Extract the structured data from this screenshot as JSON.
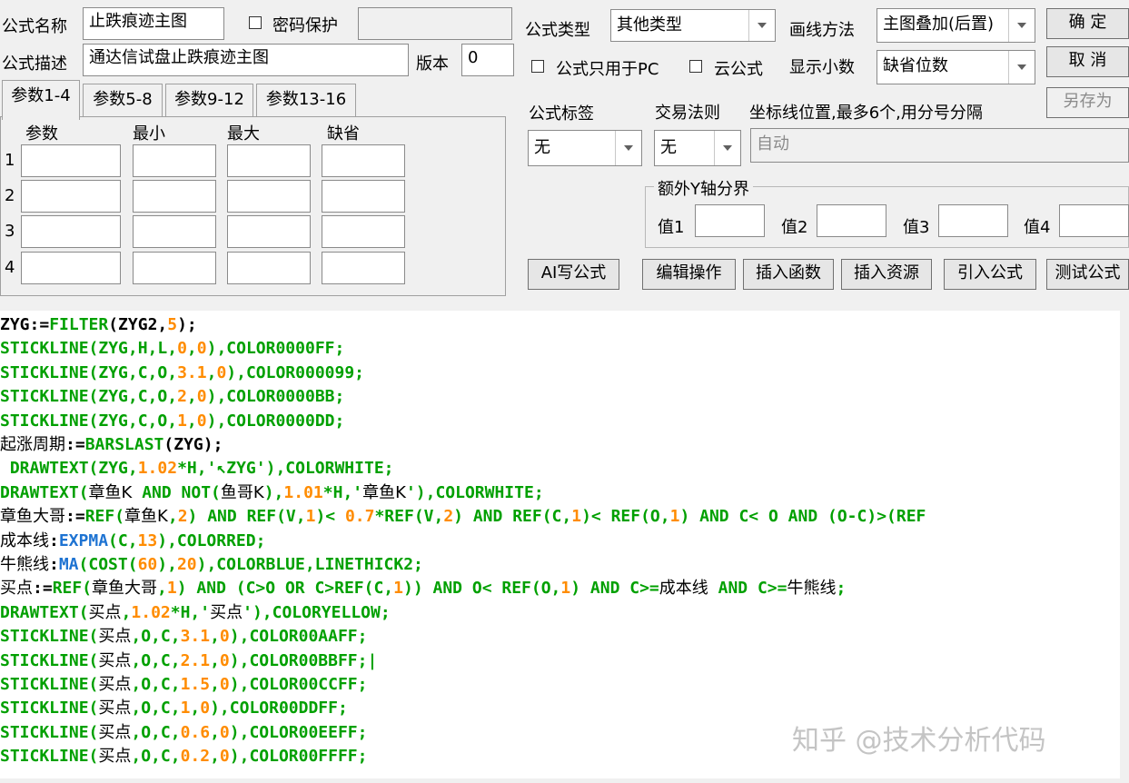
{
  "labels": {
    "formula_name": "公式名称",
    "formula_desc": "公式描述",
    "version": "版本",
    "formula_type": "公式类型",
    "draw_method": "画线方法",
    "show_decimals": "显示小数",
    "pc_only": "公式只用于PC",
    "cloud": "云公式",
    "password": "密码保护",
    "formula_tag": "公式标签",
    "trade_rule": "交易法则",
    "axis_pos": "坐标线位置,最多6个,用分号分隔",
    "extra_y": "额外Y轴分界",
    "val1": "值1",
    "val2": "值2",
    "val3": "值3",
    "val4": "值4"
  },
  "fields": {
    "formula_name": "止跌痕迹主图",
    "formula_desc": "通达信试盘止跌痕迹主图",
    "version": "0",
    "password": "",
    "axis_pos": "自动",
    "val1": "",
    "val2": "",
    "val3": "",
    "val4": ""
  },
  "combos": {
    "formula_type": "其他类型",
    "draw_method": "主图叠加(后置)",
    "show_decimals": "缺省位数",
    "formula_tag": "无",
    "trade_rule": "无"
  },
  "buttons": {
    "ok": "确  定",
    "cancel": "取  消",
    "save_as": "另存为",
    "ai": "AI写公式",
    "edit": "编辑操作",
    "insert_fn": "插入函数",
    "insert_res": "插入资源",
    "import": "引入公式",
    "test": "测试公式"
  },
  "tabs": [
    "参数1-4",
    "参数5-8",
    "参数9-12",
    "参数13-16"
  ],
  "params": {
    "headers": [
      "参数",
      "最小",
      "最大",
      "缺省"
    ],
    "rows": [
      "1",
      "2",
      "3",
      "4"
    ]
  },
  "code_lines": [
    [
      [
        "ZYG:=",
        "t-blk"
      ],
      [
        "FILTER",
        "t-fn"
      ],
      [
        "(ZYG2,",
        "t-blk"
      ],
      [
        "5",
        "t-num"
      ],
      [
        ");",
        "t-blk"
      ]
    ],
    [
      [
        "STICKLINE(ZYG,H,L,",
        "t-fn"
      ],
      [
        "0",
        "t-num"
      ],
      [
        ",",
        "t-fn"
      ],
      [
        "0",
        "t-num"
      ],
      [
        "),COLOR0000FF;",
        "t-fn"
      ]
    ],
    [
      [
        "STICKLINE(ZYG,C,O,",
        "t-fn"
      ],
      [
        "3.1",
        "t-num"
      ],
      [
        ",",
        "t-fn"
      ],
      [
        "0",
        "t-num"
      ],
      [
        "),COLOR000099;",
        "t-fn"
      ]
    ],
    [
      [
        "STICKLINE(ZYG,C,O,",
        "t-fn"
      ],
      [
        "2",
        "t-num"
      ],
      [
        ",",
        "t-fn"
      ],
      [
        "0",
        "t-num"
      ],
      [
        "),COLOR0000BB;",
        "t-fn"
      ]
    ],
    [
      [
        "STICKLINE(ZYG,C,O,",
        "t-fn"
      ],
      [
        "1",
        "t-num"
      ],
      [
        ",",
        "t-fn"
      ],
      [
        "0",
        "t-num"
      ],
      [
        "),COLOR0000DD;",
        "t-fn"
      ]
    ],
    [
      [
        "起涨周期",
        "t-cn"
      ],
      [
        ":=",
        "t-blk"
      ],
      [
        "BARSLAST",
        "t-fn"
      ],
      [
        "(ZYG);",
        "t-blk"
      ]
    ],
    [
      [
        " DRAWTEXT(ZYG,",
        "t-fn"
      ],
      [
        "1.02",
        "t-num"
      ],
      [
        "*H,'↖ZYG'),COLORWHITE;",
        "t-fn"
      ]
    ],
    [
      [
        "DRAWTEXT(",
        "t-fn"
      ],
      [
        "章鱼K",
        "t-cn"
      ],
      [
        " AND NOT(",
        "t-fn"
      ],
      [
        "鱼哥K",
        "t-cn"
      ],
      [
        "),",
        "t-fn"
      ],
      [
        "1.01",
        "t-num"
      ],
      [
        "*H,'",
        "t-fn"
      ],
      [
        "章鱼K",
        "t-cn"
      ],
      [
        "'),COLORWHITE;",
        "t-fn"
      ]
    ],
    [
      [
        "章鱼大哥",
        "t-cn"
      ],
      [
        ":=",
        "t-blk"
      ],
      [
        "REF(",
        "t-fn"
      ],
      [
        "章鱼K",
        "t-cn"
      ],
      [
        ",",
        "t-fn"
      ],
      [
        "2",
        "t-num"
      ],
      [
        ") AND REF(V,",
        "t-fn"
      ],
      [
        "1",
        "t-num"
      ],
      [
        ")< ",
        "t-fn"
      ],
      [
        "0.7",
        "t-num"
      ],
      [
        "*REF(V,",
        "t-fn"
      ],
      [
        "2",
        "t-num"
      ],
      [
        ") AND REF(C,",
        "t-fn"
      ],
      [
        "1",
        "t-num"
      ],
      [
        ")< REF(O,",
        "t-fn"
      ],
      [
        "1",
        "t-num"
      ],
      [
        ") AND C< O AND (O-C)>(REF",
        "t-fn"
      ]
    ],
    [
      [
        "成本线",
        "t-cn"
      ],
      [
        ":",
        "t-blk"
      ],
      [
        "EXPMA",
        "t-blue"
      ],
      [
        "(C,",
        "t-fn"
      ],
      [
        "13",
        "t-num"
      ],
      [
        "),COLORRED;",
        "t-fn"
      ]
    ],
    [
      [
        "牛熊线",
        "t-cn"
      ],
      [
        ":",
        "t-blk"
      ],
      [
        "MA",
        "t-blue"
      ],
      [
        "(COST(",
        "t-fn"
      ],
      [
        "60",
        "t-num"
      ],
      [
        "),",
        "t-fn"
      ],
      [
        "20",
        "t-num"
      ],
      [
        "),COLORBLUE,LINETHICK2;",
        "t-fn"
      ]
    ],
    [
      [
        "买点",
        "t-cn"
      ],
      [
        ":=",
        "t-blk"
      ],
      [
        "REF(",
        "t-fn"
      ],
      [
        "章鱼大哥",
        "t-cn"
      ],
      [
        ",",
        "t-fn"
      ],
      [
        "1",
        "t-num"
      ],
      [
        ") AND (C>O OR C>REF(C,",
        "t-fn"
      ],
      [
        "1",
        "t-num"
      ],
      [
        ")) AND O< REF(O,",
        "t-fn"
      ],
      [
        "1",
        "t-num"
      ],
      [
        ") AND C>=",
        "t-fn"
      ],
      [
        "成本线",
        "t-cn"
      ],
      [
        " AND C>=",
        "t-fn"
      ],
      [
        "牛熊线",
        "t-cn"
      ],
      [
        ";",
        "t-fn"
      ]
    ],
    [
      [
        "DRAWTEXT(",
        "t-fn"
      ],
      [
        "买点",
        "t-cn"
      ],
      [
        ",",
        "t-fn"
      ],
      [
        "1.02",
        "t-num"
      ],
      [
        "*H,'",
        "t-fn"
      ],
      [
        "买点",
        "t-cn"
      ],
      [
        "'),COLORYELLOW;",
        "t-fn"
      ]
    ],
    [
      [
        "STICKLINE(",
        "t-fn"
      ],
      [
        "买点",
        "t-cn"
      ],
      [
        ",O,C,",
        "t-fn"
      ],
      [
        "3.1",
        "t-num"
      ],
      [
        ",",
        "t-fn"
      ],
      [
        "0",
        "t-num"
      ],
      [
        "),COLOR00AAFF;",
        "t-fn"
      ]
    ],
    [
      [
        "STICKLINE(",
        "t-fn"
      ],
      [
        "买点",
        "t-cn"
      ],
      [
        ",O,C,",
        "t-fn"
      ],
      [
        "2.1",
        "t-num"
      ],
      [
        ",",
        "t-fn"
      ],
      [
        "0",
        "t-num"
      ],
      [
        "),COLOR00BBFF;|",
        "t-fn"
      ]
    ],
    [
      [
        "STICKLINE(",
        "t-fn"
      ],
      [
        "买点",
        "t-cn"
      ],
      [
        ",O,C,",
        "t-fn"
      ],
      [
        "1.5",
        "t-num"
      ],
      [
        ",",
        "t-fn"
      ],
      [
        "0",
        "t-num"
      ],
      [
        "),COLOR00CCFF;",
        "t-fn"
      ]
    ],
    [
      [
        "STICKLINE(",
        "t-fn"
      ],
      [
        "买点",
        "t-cn"
      ],
      [
        ",O,C,",
        "t-fn"
      ],
      [
        "1",
        "t-num"
      ],
      [
        ",",
        "t-fn"
      ],
      [
        "0",
        "t-num"
      ],
      [
        "),COLOR00DDFF;",
        "t-fn"
      ]
    ],
    [
      [
        "STICKLINE(",
        "t-fn"
      ],
      [
        "买点",
        "t-cn"
      ],
      [
        ",O,C,",
        "t-fn"
      ],
      [
        "0.6",
        "t-num"
      ],
      [
        ",",
        "t-fn"
      ],
      [
        "0",
        "t-num"
      ],
      [
        "),COLOR00EEFF;",
        "t-fn"
      ]
    ],
    [
      [
        "STICKLINE(",
        "t-fn"
      ],
      [
        "买点",
        "t-cn"
      ],
      [
        ",O,C,",
        "t-fn"
      ],
      [
        "0.2",
        "t-num"
      ],
      [
        ",",
        "t-fn"
      ],
      [
        "0",
        "t-num"
      ],
      [
        "),COLOR00FFFF;",
        "t-fn"
      ]
    ]
  ],
  "watermark": "知乎 @技术分析代码",
  "colors": {
    "keyword": "#00a000",
    "number": "#ff8c00",
    "function_blue": "#1e73d2",
    "text": "#000000"
  }
}
